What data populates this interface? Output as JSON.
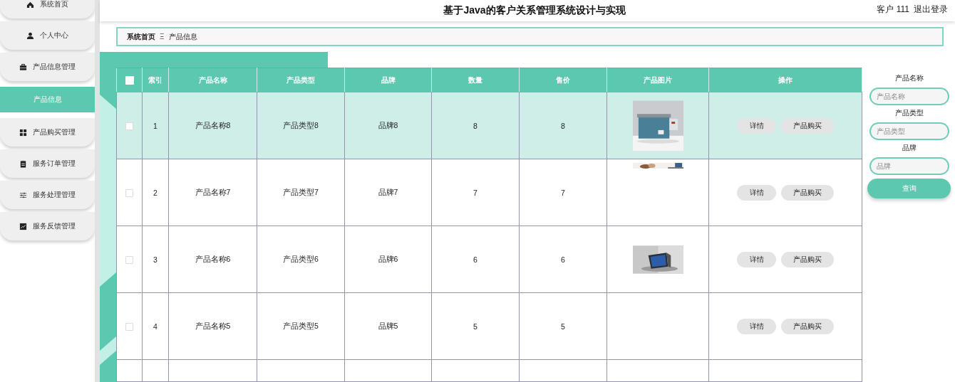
{
  "header": {
    "title": "基于Java的客户关系管理系统设计与实现",
    "user": "客户 111",
    "logout": "退出登录"
  },
  "sidebar": {
    "items": [
      {
        "label": "系统首页",
        "kind": "home",
        "selected": false
      },
      {
        "label": "个人中心",
        "kind": "user",
        "selected": false
      },
      {
        "label": "产品信息管理",
        "kind": "briefcase",
        "selected": false,
        "children": [
          {
            "label": "产品信息",
            "selected": true
          }
        ]
      },
      {
        "label": "产品购买管理",
        "kind": "grid",
        "selected": false
      },
      {
        "label": "服务订单管理",
        "kind": "clipboard",
        "selected": false
      },
      {
        "label": "服务处理管理",
        "kind": "sliders",
        "selected": false
      },
      {
        "label": "服务反馈管理",
        "kind": "chart",
        "selected": false
      }
    ]
  },
  "breadcrumb": {
    "items": [
      "系统首页",
      "产品信息"
    ],
    "separator": "Ξ"
  },
  "table": {
    "select_all": {
      "checked": false
    },
    "columns": [
      "索引",
      "产品名称",
      "产品类型",
      "品牌",
      "数量",
      "售价",
      "产品图片",
      "操作"
    ],
    "rows": [
      {
        "kind": "data",
        "selected": true,
        "checked": false,
        "index": "1",
        "name": "产品名称8",
        "type": "产品类型8",
        "brand": "品牌8",
        "quantity": "8",
        "price": "8",
        "image": {
          "kind": "picture"
        },
        "actions": [
          "详情",
          "产品购买"
        ]
      },
      {
        "kind": "data",
        "selected": false,
        "checked": false,
        "index": "2",
        "name": "产品名称7",
        "type": "产品类型7",
        "brand": "品牌7",
        "quantity": "7",
        "price": "7",
        "image": {
          "kind": "picture"
        },
        "actions": [
          "详情",
          "产品购买"
        ]
      },
      {
        "kind": "data",
        "selected": false,
        "checked": false,
        "index": "3",
        "name": "产品名称6",
        "type": "产品类型6",
        "brand": "品牌6",
        "quantity": "6",
        "price": "6",
        "image": {
          "kind": "picture"
        },
        "actions": [
          "详情",
          "产品购买"
        ]
      },
      {
        "kind": "data",
        "selected": false,
        "checked": false,
        "index": "4",
        "name": "产品名称5",
        "type": "产品类型5",
        "brand": "品牌5",
        "quantity": "5",
        "price": "5",
        "actions": [
          "详情",
          "产品购买"
        ]
      },
      {
        "kind": "cut_off"
      }
    ]
  },
  "search": {
    "fields": [
      {
        "label": "产品名称",
        "placeholder": "产品名称"
      },
      {
        "label": "产品类型",
        "placeholder": "产品类型"
      },
      {
        "label": "品牌",
        "placeholder": "品牌"
      }
    ],
    "button": "查询"
  }
}
